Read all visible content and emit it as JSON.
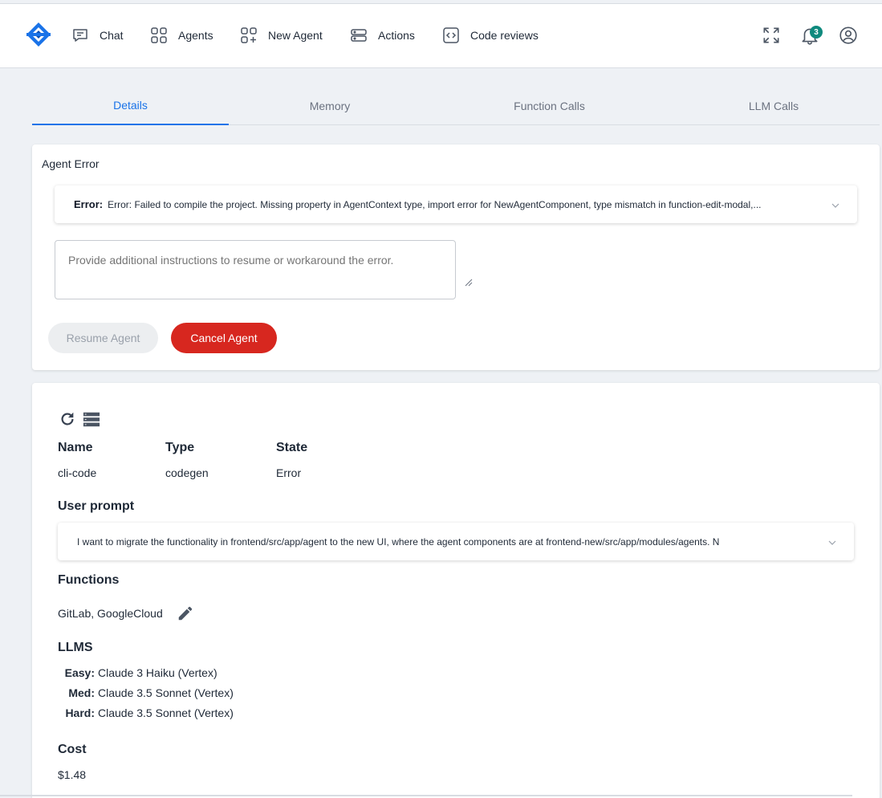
{
  "nav": {
    "items": [
      {
        "label": "Chat",
        "icon": "chat-icon"
      },
      {
        "label": "Agents",
        "icon": "agents-icon"
      },
      {
        "label": "New Agent",
        "icon": "new-agent-icon"
      },
      {
        "label": "Actions",
        "icon": "actions-icon"
      },
      {
        "label": "Code reviews",
        "icon": "code-icon"
      }
    ],
    "notification_count": "3"
  },
  "tabs": [
    "Details",
    "Memory",
    "Function Calls",
    "LLM Calls"
  ],
  "active_tab": "Details",
  "error_card": {
    "title": "Agent Error",
    "error_label": "Error:",
    "error_text": "Error: Failed to compile the project. Missing property in AgentContext type, import error for NewAgentComponent, type mismatch in function-edit-modal,...",
    "instructions_placeholder": "Provide additional instructions to resume or workaround the error.",
    "resume_label": "Resume Agent",
    "cancel_label": "Cancel Agent"
  },
  "details": {
    "name_label": "Name",
    "type_label": "Type",
    "state_label": "State",
    "name": "cli-code",
    "type": "codegen",
    "state": "Error",
    "user_prompt_label": "User prompt",
    "user_prompt": "I want to migrate the functionality in frontend/src/app/agent to the new UI, where the agent components are at frontend-new/src/app/modules/agents. N",
    "functions_label": "Functions",
    "functions": "GitLab, GoogleCloud",
    "llms_label": "LLMS",
    "llms": [
      {
        "level": "Easy:",
        "model": "Claude 3 Haiku (Vertex)"
      },
      {
        "level": "Med:",
        "model": "Claude 3.5 Sonnet (Vertex)"
      },
      {
        "level": "Hard:",
        "model": "Claude 3.5 Sonnet (Vertex)"
      }
    ],
    "cost_label": "Cost",
    "cost": "$1.48"
  },
  "colors": {
    "accent": "#1a73e8",
    "danger": "#d7271f",
    "badge": "#0f8a7e",
    "logo": "#1a73e8"
  }
}
